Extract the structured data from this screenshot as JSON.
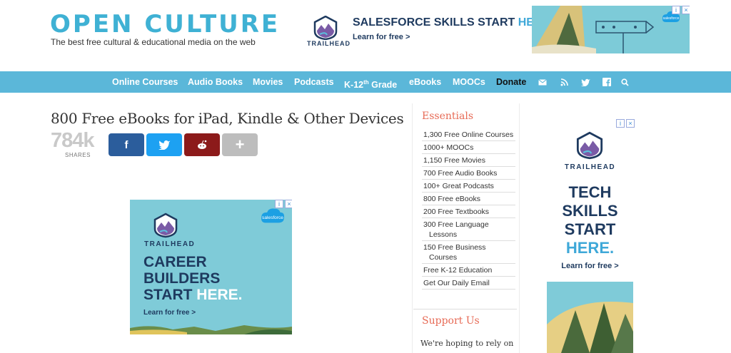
{
  "header": {
    "logo": "OPEN CULTURE",
    "tagline": "The best free cultural & educational media on the web"
  },
  "top_ad": {
    "brand": "TRAILHEAD",
    "headline_a": "SALESFORCE SKILLS START ",
    "headline_b": "HERE.",
    "cta": "Learn for free >",
    "sponsor": "salesforce"
  },
  "nav": {
    "items": [
      "Online Courses",
      "Audio Books",
      "Movies",
      "Podcasts",
      "K-12",
      "eBooks",
      "MOOCs",
      "Donate"
    ],
    "k12_sup": "th",
    "k12_suffix": " Grade",
    "icons": [
      "mail-icon",
      "rss-icon",
      "twitter-icon",
      "facebook-icon",
      "search-icon"
    ]
  },
  "article": {
    "title": "800 Free eBooks for iPad, Kindle & Other Devices",
    "share_count": "784k",
    "share_label": "SHARES",
    "share_buttons": [
      {
        "name": "facebook",
        "glyph": "f",
        "color": "#2b5d9c"
      },
      {
        "name": "twitter",
        "glyph": "🐦",
        "color": "#1da1f2"
      },
      {
        "name": "reddit",
        "glyph": "👽",
        "color": "#8c1a1a"
      },
      {
        "name": "more",
        "glyph": "+",
        "color": "#bdbdbd"
      }
    ]
  },
  "inline_ad": {
    "brand": "TRAILHEAD",
    "line1": "CAREER",
    "line2": "BUILDERS",
    "line3a": "START ",
    "line3b": "HERE.",
    "cta": "Learn for free >",
    "sponsor": "salesforce"
  },
  "sidebar": {
    "essentials_title": "Essentials",
    "essentials": [
      {
        "a": "1,300 Free Online Courses"
      },
      {
        "a": "1000+ MOOCs"
      },
      {
        "a": "1,150 Free Movies"
      },
      {
        "a": "700 Free Audio Books"
      },
      {
        "a": "100+ Great Podcasts"
      },
      {
        "a": "800 Free eBooks"
      },
      {
        "a": "200 Free Textbooks"
      },
      {
        "a": "300 Free Language",
        "b": "Lessons"
      },
      {
        "a": "150 Free Business",
        "b": "Courses"
      },
      {
        "a": "Free K-12 Education"
      },
      {
        "a": "Get Our Daily Email"
      }
    ],
    "support_title": "Support Us",
    "support_text": "We're hoping to rely on"
  },
  "side_ad": {
    "brand": "TRAILHEAD",
    "line1": "TECH",
    "line2": "SKILLS",
    "line3": "START",
    "line4": "HERE.",
    "cta": "Learn for free >"
  }
}
